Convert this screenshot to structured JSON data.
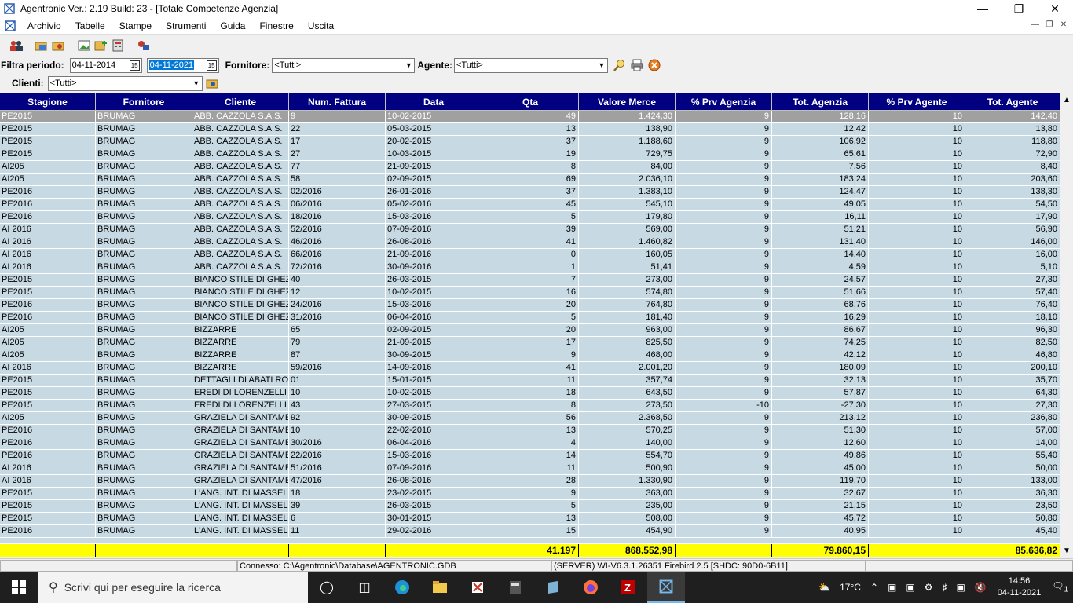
{
  "window": {
    "title": "Agentronic Ver.: 2.19 Build: 23  - [Totale Competenze Agenzia]"
  },
  "menu": [
    "Archivio",
    "Tabelle",
    "Stampe",
    "Strumenti",
    "Guida",
    "Finestre",
    "Uscita"
  ],
  "filters": {
    "periodo_label": "Filtra periodo:",
    "date_from": "04-11-2014",
    "date_to": "04-11-2021",
    "fornitore_label": "Fornitore:",
    "fornitore_value": "<Tutti>",
    "agente_label": "Agente:",
    "agente_value": "<Tutti>",
    "clienti_label": "Clienti:",
    "clienti_value": "<Tutti>"
  },
  "columns": [
    "Stagione",
    "Fornitore",
    "Cliente",
    "Num. Fattura",
    "Data",
    "Qta",
    "Valore Merce",
    "% Prv Agenzia",
    "Tot. Agenzia",
    "% Prv Agente",
    "Tot. Agente"
  ],
  "rows": [
    [
      "PE2015",
      "BRUMAG",
      "ABB. CAZZOLA S.A.S.",
      "9",
      "10-02-2015",
      "49",
      "1.424,30",
      "9",
      "128,16",
      "10",
      "142,40"
    ],
    [
      "PE2015",
      "BRUMAG",
      "ABB. CAZZOLA S.A.S.",
      "22",
      "05-03-2015",
      "13",
      "138,90",
      "9",
      "12,42",
      "10",
      "13,80"
    ],
    [
      "PE2015",
      "BRUMAG",
      "ABB. CAZZOLA S.A.S.",
      "17",
      "20-02-2015",
      "37",
      "1.188,60",
      "9",
      "106,92",
      "10",
      "118,80"
    ],
    [
      "PE2015",
      "BRUMAG",
      "ABB. CAZZOLA S.A.S.",
      "27",
      "10-03-2015",
      "19",
      "729,75",
      "9",
      "65,61",
      "10",
      "72,90"
    ],
    [
      "AI205",
      "BRUMAG",
      "ABB. CAZZOLA S.A.S.",
      "77",
      "21-09-2015",
      "8",
      "84,00",
      "9",
      "7,56",
      "10",
      "8,40"
    ],
    [
      "AI205",
      "BRUMAG",
      "ABB. CAZZOLA S.A.S.",
      "58",
      "02-09-2015",
      "69",
      "2.036,10",
      "9",
      "183,24",
      "10",
      "203,60"
    ],
    [
      "PE2016",
      "BRUMAG",
      "ABB. CAZZOLA S.A.S.",
      "02/2016",
      "26-01-2016",
      "37",
      "1.383,10",
      "9",
      "124,47",
      "10",
      "138,30"
    ],
    [
      "PE2016",
      "BRUMAG",
      "ABB. CAZZOLA S.A.S.",
      "06/2016",
      "05-02-2016",
      "45",
      "545,10",
      "9",
      "49,05",
      "10",
      "54,50"
    ],
    [
      "PE2016",
      "BRUMAG",
      "ABB. CAZZOLA S.A.S.",
      "18/2016",
      "15-03-2016",
      "5",
      "179,80",
      "9",
      "16,11",
      "10",
      "17,90"
    ],
    [
      "AI 2016",
      "BRUMAG",
      "ABB. CAZZOLA S.A.S.",
      "52/2016",
      "07-09-2016",
      "39",
      "569,00",
      "9",
      "51,21",
      "10",
      "56,90"
    ],
    [
      "AI 2016",
      "BRUMAG",
      "ABB. CAZZOLA S.A.S.",
      "46/2016",
      "26-08-2016",
      "41",
      "1.460,82",
      "9",
      "131,40",
      "10",
      "146,00"
    ],
    [
      "AI 2016",
      "BRUMAG",
      "ABB. CAZZOLA S.A.S.",
      "66/2016",
      "21-09-2016",
      "0",
      "160,05",
      "9",
      "14,40",
      "10",
      "16,00"
    ],
    [
      "AI 2016",
      "BRUMAG",
      "ABB. CAZZOLA S.A.S.",
      "72/2016",
      "30-09-2016",
      "1",
      "51,41",
      "9",
      "4,59",
      "10",
      "5,10"
    ],
    [
      "PE2015",
      "BRUMAG",
      "BIANCO STILE DI GHEZ",
      "40",
      "26-03-2015",
      "7",
      "273,00",
      "9",
      "24,57",
      "10",
      "27,30"
    ],
    [
      "PE2015",
      "BRUMAG",
      "BIANCO STILE DI GHEZ",
      "12",
      "10-02-2015",
      "16",
      "574,80",
      "9",
      "51,66",
      "10",
      "57,40"
    ],
    [
      "PE2016",
      "BRUMAG",
      "BIANCO STILE DI GHEZ",
      "24/2016",
      "15-03-2016",
      "20",
      "764,80",
      "9",
      "68,76",
      "10",
      "76,40"
    ],
    [
      "PE2016",
      "BRUMAG",
      "BIANCO STILE DI GHEZ",
      "31/2016",
      "06-04-2016",
      "5",
      "181,40",
      "9",
      "16,29",
      "10",
      "18,10"
    ],
    [
      "AI205",
      "BRUMAG",
      "BIZZARRE",
      "65",
      "02-09-2015",
      "20",
      "963,00",
      "9",
      "86,67",
      "10",
      "96,30"
    ],
    [
      "AI205",
      "BRUMAG",
      "BIZZARRE",
      "79",
      "21-09-2015",
      "17",
      "825,50",
      "9",
      "74,25",
      "10",
      "82,50"
    ],
    [
      "AI205",
      "BRUMAG",
      "BIZZARRE",
      "87",
      "30-09-2015",
      "9",
      "468,00",
      "9",
      "42,12",
      "10",
      "46,80"
    ],
    [
      "AI 2016",
      "BRUMAG",
      "BIZZARRE",
      "59/2016",
      "14-09-2016",
      "41",
      "2.001,20",
      "9",
      "180,09",
      "10",
      "200,10"
    ],
    [
      "PE2015",
      "BRUMAG",
      "DETTAGLI DI ABATI RO",
      "01",
      "15-01-2015",
      "11",
      "357,74",
      "9",
      "32,13",
      "10",
      "35,70"
    ],
    [
      "PE2015",
      "BRUMAG",
      "EREDI DI LORENZELLI .",
      "10",
      "10-02-2015",
      "18",
      "643,50",
      "9",
      "57,87",
      "10",
      "64,30"
    ],
    [
      "PE2015",
      "BRUMAG",
      "EREDI DI LORENZELLI .",
      "43",
      "27-03-2015",
      "8",
      "273,50",
      "-10",
      "-27,30",
      "10",
      "27,30"
    ],
    [
      "AI205",
      "BRUMAG",
      "GRAZIELA DI SANTAME",
      "92",
      "30-09-2015",
      "56",
      "2.368,50",
      "9",
      "213,12",
      "10",
      "236,80"
    ],
    [
      "PE2016",
      "BRUMAG",
      "GRAZIELA DI SANTAME",
      "10",
      "22-02-2016",
      "13",
      "570,25",
      "9",
      "51,30",
      "10",
      "57,00"
    ],
    [
      "PE2016",
      "BRUMAG",
      "GRAZIELA DI SANTAME",
      "30/2016",
      "06-04-2016",
      "4",
      "140,00",
      "9",
      "12,60",
      "10",
      "14,00"
    ],
    [
      "PE2016",
      "BRUMAG",
      "GRAZIELA DI SANTAME",
      "22/2016",
      "15-03-2016",
      "14",
      "554,70",
      "9",
      "49,86",
      "10",
      "55,40"
    ],
    [
      "AI 2016",
      "BRUMAG",
      "GRAZIELA DI SANTAME",
      "51/2016",
      "07-09-2016",
      "11",
      "500,90",
      "9",
      "45,00",
      "10",
      "50,00"
    ],
    [
      "AI 2016",
      "BRUMAG",
      "GRAZIELA DI SANTAME",
      "47/2016",
      "26-08-2016",
      "28",
      "1.330,90",
      "9",
      "119,70",
      "10",
      "133,00"
    ],
    [
      "PE2015",
      "BRUMAG",
      "L'ANG. INT. DI MASSELI",
      "18",
      "23-02-2015",
      "9",
      "363,00",
      "9",
      "32,67",
      "10",
      "36,30"
    ],
    [
      "PE2015",
      "BRUMAG",
      "L'ANG. INT. DI MASSELI",
      "39",
      "26-03-2015",
      "5",
      "235,00",
      "9",
      "21,15",
      "10",
      "23,50"
    ],
    [
      "PE2015",
      "BRUMAG",
      "L'ANG. INT. DI MASSELI",
      "6",
      "30-01-2015",
      "13",
      "508,00",
      "9",
      "45,72",
      "10",
      "50,80"
    ],
    [
      "PE2016",
      "BRUMAG",
      "L'ANG. INT. DI MASSELI",
      "11",
      "29-02-2016",
      "15",
      "454,90",
      "9",
      "40,95",
      "10",
      "45,40"
    ]
  ],
  "totals": [
    "",
    "",
    "",
    "",
    "",
    "41.197",
    "868.552,98",
    "",
    "79.860,15",
    "",
    "85.636,82"
  ],
  "status": {
    "connection": "Connesso: C:\\Agentronic\\Database\\AGENTRONIC.GDB",
    "server": "(SERVER) WI-V6.3.1.26351 Firebird 2.5 [SHDC: 90D0-6B11]"
  },
  "taskbar": {
    "search_placeholder": "Scrivi qui per eseguire la ricerca",
    "temperature": "17°C",
    "time": "14:56",
    "date": "04-11-2021",
    "notifications": "1"
  }
}
